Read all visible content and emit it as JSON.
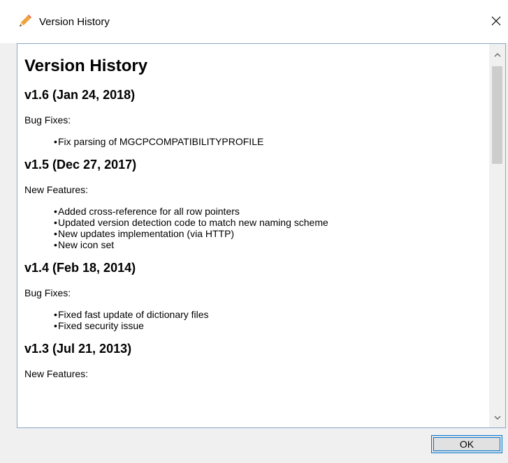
{
  "window": {
    "title": "Version History",
    "close_icon": "close-icon",
    "app_icon": "pencil-icon"
  },
  "doc": {
    "heading": "Version History",
    "versions": [
      {
        "title": "v1.6 (Jan 24, 2018)",
        "section": "Bug Fixes:",
        "items": [
          "Fix parsing of MGCPCOMPATIBILITYPROFILE"
        ]
      },
      {
        "title": "v1.5 (Dec 27, 2017)",
        "section": "New Features:",
        "items": [
          "Added cross-reference for all row pointers",
          "Updated version detection code to match new naming scheme",
          "New updates implementation (via HTTP)",
          "New icon set"
        ]
      },
      {
        "title": "v1.4 (Feb 18, 2014)",
        "section": "Bug Fixes:",
        "items": [
          "Fixed fast update of dictionary files",
          "Fixed security issue"
        ]
      },
      {
        "title": "v1.3 (Jul 21, 2013)",
        "section": "New Features:",
        "items": []
      }
    ]
  },
  "footer": {
    "ok_label": "OK"
  },
  "colors": {
    "accent": "#0078d7",
    "frame_border": "#8aa6c9",
    "chrome": "#f0f0f0"
  }
}
